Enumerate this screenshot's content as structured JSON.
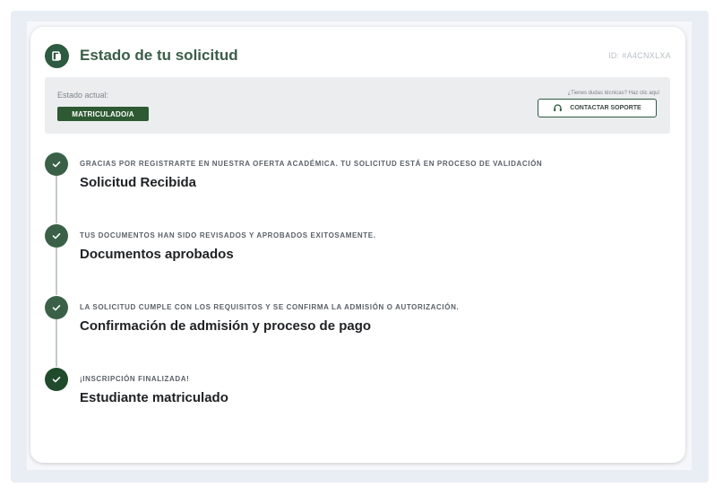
{
  "header": {
    "title": "Estado de tu solicitud",
    "request_id": "ID: #A4CNXLXA",
    "icon": "document-status-icon"
  },
  "status": {
    "label": "Estado actual:",
    "badge": "MATRICULADO/A",
    "badge_color": "#2d5a33",
    "help_text": "¿Tienes dudas técnicas? Haz clic aquí",
    "support_button": "CONTACTAR SOPORTE",
    "support_icon": "headset-icon"
  },
  "steps": [
    {
      "caption": "GRACIAS POR REGISTRARTE EN NUESTRA OFERTA ACADÉMICA. TU SOLICITUD ESTÁ EN PROCESO DE VALIDACIÓN",
      "title": "Solicitud Recibida",
      "icon": "check-icon"
    },
    {
      "caption": "TUS DOCUMENTOS HAN SIDO REVISADOS Y APROBADOS EXITOSAMENTE.",
      "title": "Documentos aprobados",
      "icon": "check-icon"
    },
    {
      "caption": "LA SOLICITUD CUMPLE CON LOS REQUISITOS Y SE CONFIRMA LA ADMISIÓN O AUTORIZACIÓN.",
      "title": "Confirmación de admisión y proceso de pago",
      "icon": "check-icon"
    },
    {
      "caption": "¡INSCRIPCIÓN FINALIZADA!",
      "title": "Estudiante matriculado",
      "icon": "check-icon"
    }
  ],
  "colors": {
    "accent": "#2d5a40",
    "title": "#3a5e47",
    "step_completed": "#3a6148"
  }
}
